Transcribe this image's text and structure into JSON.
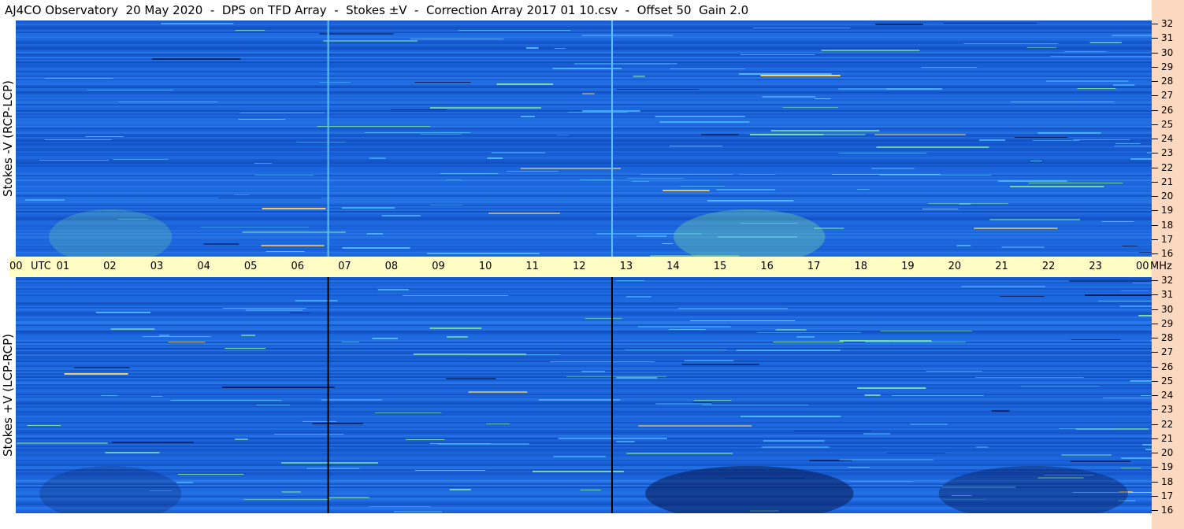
{
  "title": "AJ4CO Observatory  20 May 2020  -  DPS on TFD Array  -  Stokes ±V  -  Correction Array 2017 01 10.csv  -  Offset 50  Gain 2.0",
  "colors": {
    "background_field": "#1a60d8",
    "time_axis_bg": "#fffdc4",
    "freq_axis_bg": "#fbd9c0",
    "bright_emission": "#7de0a0",
    "hot_emission": "#ffd35a",
    "dark_absorption": "#071a52"
  },
  "chart_data": [
    {
      "type": "heatmap",
      "panel": "top",
      "ylabel": "Stokes -V (RCP-LCP)",
      "x_ticks": [
        "00",
        "UTC",
        "01",
        "02",
        "03",
        "04",
        "05",
        "06",
        "07",
        "08",
        "09",
        "10",
        "11",
        "12",
        "13",
        "14",
        "15",
        "16",
        "17",
        "18",
        "19",
        "20",
        "21",
        "22",
        "23",
        "00",
        "MHz"
      ],
      "x_range_utc_hours": [
        0,
        24
      ],
      "y_ticks": [
        "16",
        "17",
        "18",
        "19",
        "20",
        "21",
        "22",
        "23",
        "24",
        "25",
        "26",
        "27",
        "28",
        "29",
        "30",
        "31",
        "32"
      ],
      "y_range_mhz": [
        16,
        32
      ],
      "vertical_markers_utc_hours": [
        6.6,
        12.6
      ],
      "marker_color": "#5fc0ff",
      "dark_edge_frac": 0.0
    },
    {
      "type": "heatmap",
      "panel": "bottom",
      "ylabel": "Stokes +V (LCP-RCP)",
      "x_range_utc_hours": [
        0,
        24
      ],
      "y_ticks": [
        "16",
        "17",
        "18",
        "19",
        "20",
        "21",
        "22",
        "23",
        "24",
        "25",
        "26",
        "27",
        "28",
        "29",
        "30",
        "31",
        "32"
      ],
      "y_range_mhz": [
        16,
        32
      ],
      "vertical_markers_utc_hours": [
        6.6,
        12.6
      ],
      "marker_color": "#000000",
      "dark_edge_frac": 0.6
    }
  ]
}
